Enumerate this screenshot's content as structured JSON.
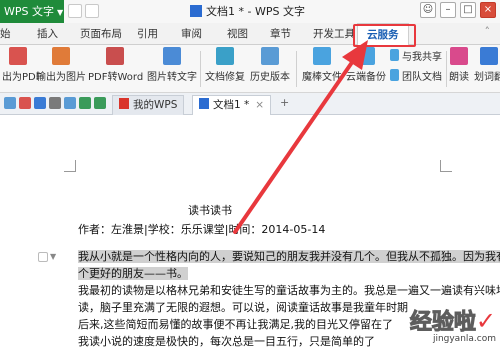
{
  "titlebar": {
    "app_menu": "WPS 文字",
    "doc_title": "文档1 * - WPS 文字"
  },
  "tabs": [
    "始",
    "插入",
    "页面布局",
    "引用",
    "审阅",
    "视图",
    "章节",
    "开发工具",
    "云服务"
  ],
  "toolbar": {
    "buttons": [
      {
        "label": "出为PDF",
        "color": "#d9534f"
      },
      {
        "label": "输出为图片",
        "color": "#e07b39"
      },
      {
        "label": "PDF转Word",
        "color": "#c94e4e"
      },
      {
        "label": "图片转文字",
        "color": "#4b8bd6"
      },
      {
        "label": "文档修复",
        "color": "#3aa0c8"
      },
      {
        "label": "历史版本",
        "color": "#5a9bd5"
      },
      {
        "label": "魔棒文件",
        "color": "#4aa3df"
      },
      {
        "label": "云端备份",
        "color": "#4aa3df"
      },
      {
        "label": "朗读",
        "color": "#d94a8c"
      },
      {
        "label": "划词翻",
        "color": "#3a7bd5"
      }
    ],
    "small_buttons": [
      {
        "label": "与我共享",
        "color": "#4aa3df"
      },
      {
        "label": "团队文档",
        "color": "#4aa3df"
      }
    ]
  },
  "doc_tabs": {
    "mywps": "我的WPS",
    "doc": "文档1 *",
    "close": "×"
  },
  "document": {
    "heading": "读书读书",
    "meta_author": "作者：左淮景",
    "meta_school": "学校：乐乐课堂",
    "meta_time": "时间：2014-05-14",
    "meta_sep": "|",
    "lines": [
      "我从小就是一个性格内向的人，要说知己的朋友我并没有几个。但我从不孤独。因为我有一",
      "个更好的朋友——书。",
      "我最初的读物是以格林兄弟和安徒生写的童话故事为主的。我总是一遍又一遍读有兴味地",
      "读，脑子里充满了无限的遐想。可以说，阅读童话故事是我童年时期",
      "后来,这些简短而易懂的故事便不再让我满足,我的目光又停留在了",
      "我读小说的速度是极快的，每次总是一目五行，只是简单的了"
    ]
  },
  "watermark": {
    "main": "经验啦",
    "check": "✓",
    "url": "jingyanla.com"
  },
  "colors": {
    "accent_red": "#e8383d",
    "wps_green": "#1f8b3a",
    "active_tab_blue": "#1a5fb4"
  }
}
